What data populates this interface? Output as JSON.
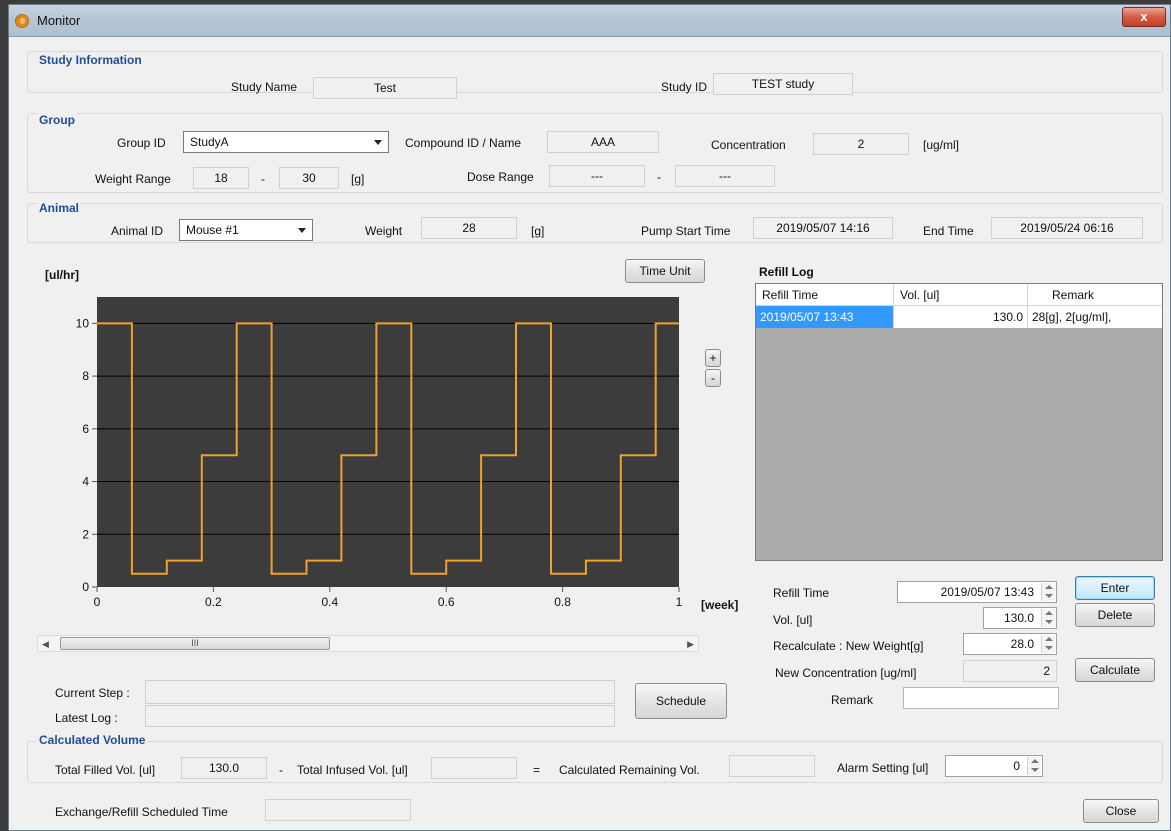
{
  "window": {
    "title": "Monitor",
    "close_glyph": "x"
  },
  "study": {
    "section_title": "Study Information",
    "name_label": "Study Name",
    "name_value": "Test",
    "id_label": "Study ID",
    "id_value": "TEST study"
  },
  "group": {
    "section_title": "Group",
    "group_id_label": "Group ID",
    "group_id_value": "StudyA",
    "compound_label": "Compound ID / Name",
    "compound_value": "AAA",
    "concentration_label": "Concentration",
    "concentration_value": "2",
    "concentration_unit": "[ug/ml]",
    "weight_range_label": "Weight Range",
    "weight_min": "18",
    "weight_dash": "-",
    "weight_max": "30",
    "weight_unit": "[g]",
    "dose_range_label": "Dose Range",
    "dose_min": "---",
    "dose_dash": "-",
    "dose_max": "---"
  },
  "animal": {
    "section_title": "Animal",
    "animal_id_label": "Animal ID",
    "animal_id_value": "Mouse #1",
    "weight_label": "Weight",
    "weight_value": "28",
    "weight_unit": "[g]",
    "pump_start_label": "Pump Start Time",
    "pump_start_value": "2019/05/07 14:16",
    "end_time_label": "End Time",
    "end_time_value": "2019/05/24 06:16"
  },
  "chart_controls": {
    "time_unit_button": "Time Unit",
    "zoom_in": "+",
    "zoom_out": "-",
    "scroll_thumb_grip": "III"
  },
  "chart_data": {
    "type": "line",
    "ylabel": "[ul/hr]",
    "xlabel": "[week]",
    "xlim": [
      0,
      1
    ],
    "ylim": [
      0,
      11
    ],
    "x_ticks": [
      0,
      0.2,
      0.4,
      0.6,
      0.8,
      1
    ],
    "x_tick_labels": [
      "0",
      "0.2",
      "0.4",
      "0.6",
      "0.8",
      "1"
    ],
    "y_ticks": [
      0,
      2,
      4,
      6,
      8,
      10
    ],
    "y_tick_labels": [
      "0",
      "2",
      "4",
      "6",
      "8",
      "10"
    ],
    "grid": true,
    "background": "#3c3c3c",
    "series": [
      {
        "color": "#f0a030",
        "step_points": [
          [
            0,
            10
          ],
          [
            0.06,
            10
          ],
          [
            0.06,
            0.5
          ],
          [
            0.12,
            0.5
          ],
          [
            0.12,
            1
          ],
          [
            0.18,
            1
          ],
          [
            0.18,
            5
          ],
          [
            0.24,
            5
          ],
          [
            0.24,
            10
          ],
          [
            0.3,
            10
          ],
          [
            0.3,
            0.5
          ],
          [
            0.36,
            0.5
          ],
          [
            0.36,
            1
          ],
          [
            0.42,
            1
          ],
          [
            0.42,
            5
          ],
          [
            0.48,
            5
          ],
          [
            0.48,
            10
          ],
          [
            0.54,
            10
          ],
          [
            0.54,
            0.5
          ],
          [
            0.6,
            0.5
          ],
          [
            0.6,
            1
          ],
          [
            0.66,
            1
          ],
          [
            0.66,
            5
          ],
          [
            0.72,
            5
          ],
          [
            0.72,
            10
          ],
          [
            0.78,
            10
          ],
          [
            0.78,
            0.5
          ],
          [
            0.84,
            0.5
          ],
          [
            0.84,
            1
          ],
          [
            0.9,
            1
          ],
          [
            0.9,
            5
          ],
          [
            0.96,
            5
          ],
          [
            0.96,
            10
          ],
          [
            1,
            10
          ]
        ]
      }
    ]
  },
  "refill_log": {
    "title": "Refill Log",
    "columns": [
      "Refill Time",
      "Vol. [ul]",
      "Remark"
    ],
    "rows": [
      {
        "time": "2019/05/07 13:43",
        "vol": "130.0",
        "remark": "28[g], 2[ug/ml],"
      }
    ]
  },
  "refill_form": {
    "refill_time_label": "Refill Time",
    "refill_time_value": "2019/05/07 13:43",
    "vol_label": "Vol. [ul]",
    "vol_value": "130.0",
    "recalc_label": "Recalculate :  New Weight[g]",
    "recalc_value": "28.0",
    "new_conc_label": "New Concentration [ug/ml]",
    "new_conc_value": "2",
    "remark_label": "Remark",
    "remark_value": "",
    "enter_button": "Enter",
    "delete_button": "Delete",
    "calculate_button": "Calculate"
  },
  "status": {
    "current_step_label": "Current Step :",
    "current_step_value": "",
    "latest_log_label": "Latest Log :",
    "latest_log_value": "",
    "schedule_button": "Schedule"
  },
  "calculated_volume": {
    "section_title": "Calculated Volume",
    "total_filled_label": "Total Filled Vol. [ul]",
    "total_filled_value": "130.0",
    "minus": "-",
    "total_infused_label": "Total Infused Vol. [ul]",
    "total_infused_value": "",
    "equals": "=",
    "remaining_label": "Calculated Remaining Vol.",
    "remaining_value": "",
    "alarm_label": "Alarm Setting [ul]",
    "alarm_value": "0"
  },
  "footer": {
    "scheduled_label": "Exchange/Refill Scheduled Time",
    "scheduled_value": "",
    "close_button": "Close"
  }
}
